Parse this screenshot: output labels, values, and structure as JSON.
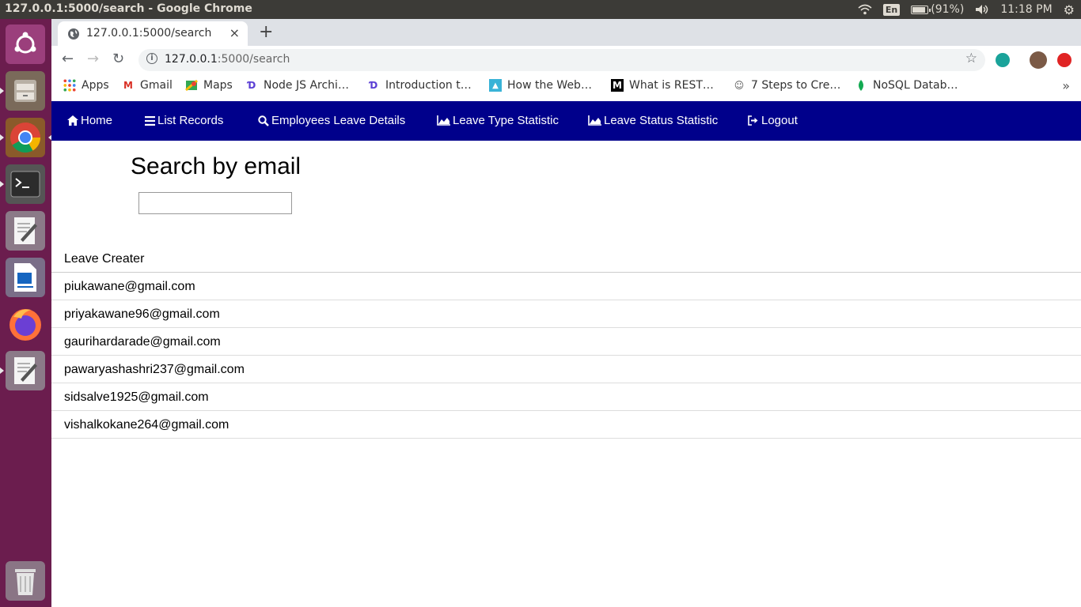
{
  "os": {
    "window_title": "127.0.0.1:5000/search - Google Chrome",
    "lang": "En",
    "battery": "(91%)",
    "time": "11:18 PM"
  },
  "browser": {
    "tab_title": "127.0.0.1:5000/search",
    "url_host": "127.0.0.1",
    "url_path": ":5000/search",
    "bookmarks": [
      {
        "label": "Apps",
        "icon": "apps-grid-icon"
      },
      {
        "label": "Gmail",
        "icon": "gmail-icon"
      },
      {
        "label": "Maps",
        "icon": "maps-icon"
      },
      {
        "label": "Node JS Archi…",
        "icon": "d-logo-icon"
      },
      {
        "label": "Introduction t…",
        "icon": "d-logo-icon"
      },
      {
        "label": "How the Web…",
        "icon": "web-icon"
      },
      {
        "label": "What is REST…",
        "icon": "medium-icon"
      },
      {
        "label": "7 Steps to Cre…",
        "icon": "face-icon"
      },
      {
        "label": "NoSQL Datab…",
        "icon": "leaf-icon"
      }
    ]
  },
  "nav": {
    "home": "Home",
    "list": "List Records",
    "employees": "Employees Leave Details",
    "leave_type": "Leave Type Statistic",
    "leave_status": "Leave Status Statistic",
    "logout": "Logout"
  },
  "search": {
    "heading": "Search by email",
    "value": "",
    "placeholder": ""
  },
  "table": {
    "header": "Leave Creater",
    "rows": [
      "piukawane@gmail.com",
      "priyakawane96@gmail.com",
      "gaurihardarade@gmail.com",
      "pawaryashashri237@gmail.com",
      "sidsalve1925@gmail.com",
      "vishalkokane264@gmail.com"
    ]
  },
  "colors": {
    "navbar": "#00008b",
    "launcher": "#6b1d4e",
    "topbar": "#3c3b37"
  }
}
